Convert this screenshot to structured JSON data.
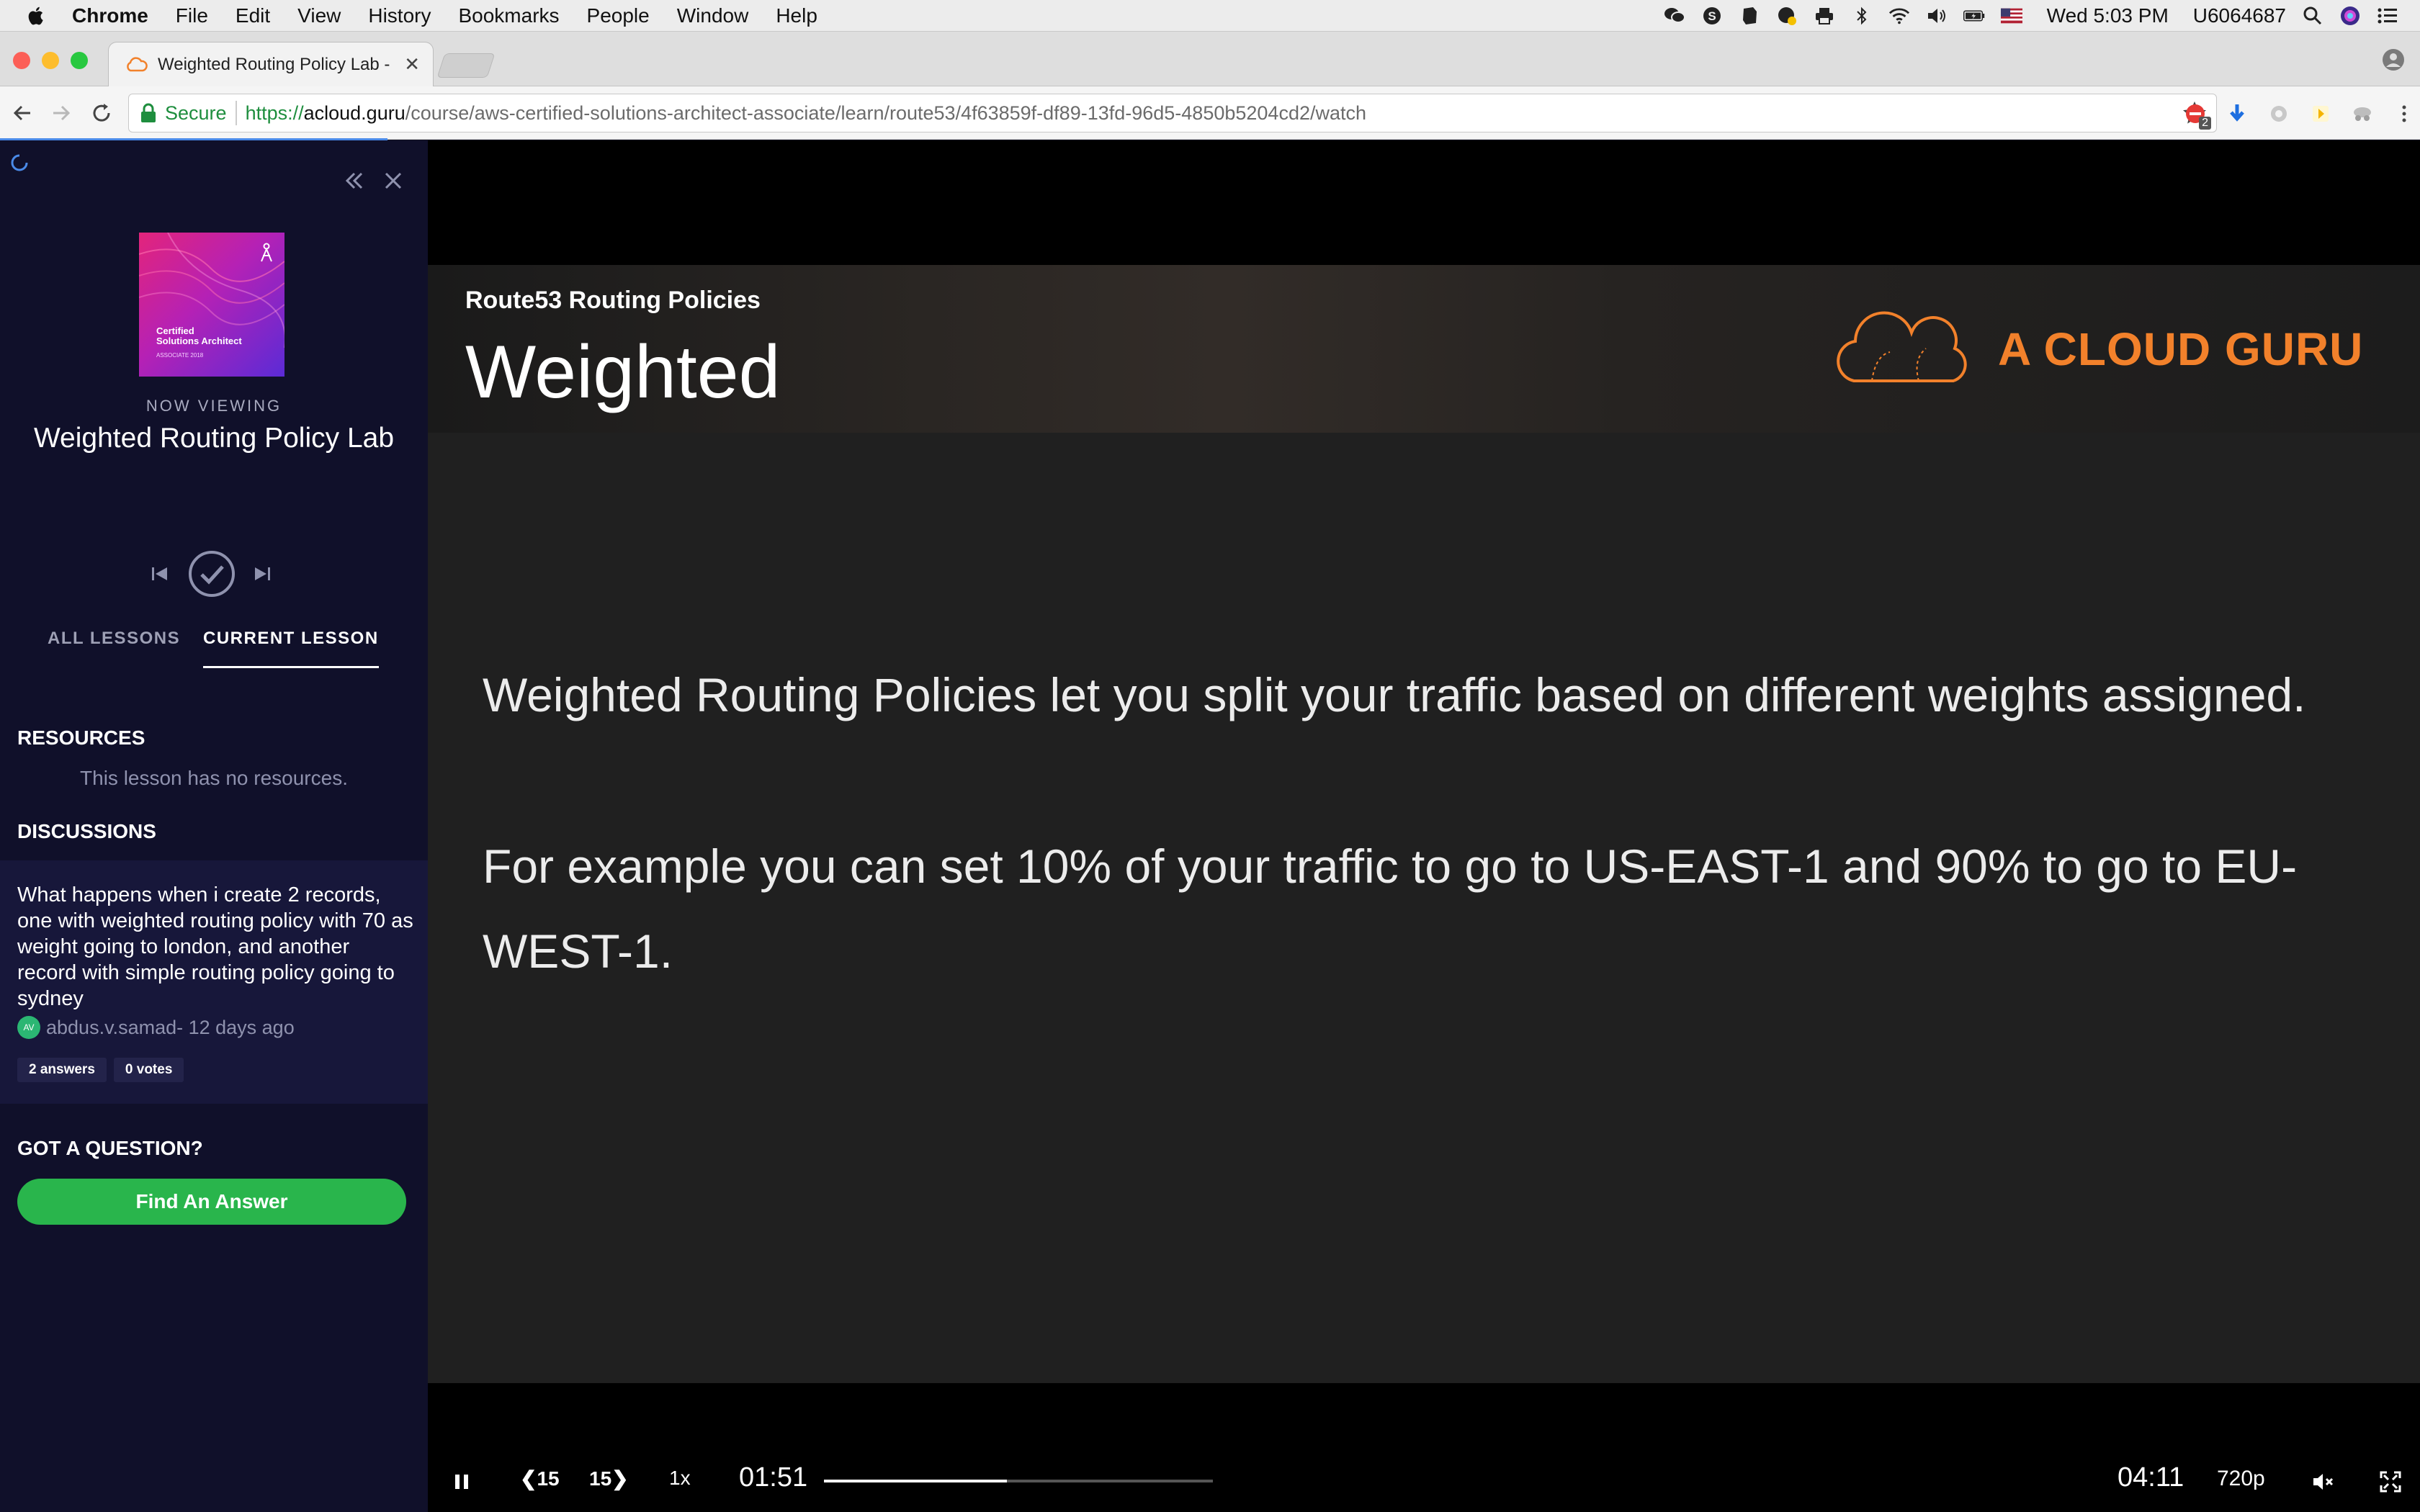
{
  "menubar": {
    "app": "Chrome",
    "items": [
      "File",
      "Edit",
      "View",
      "History",
      "Bookmarks",
      "People",
      "Window",
      "Help"
    ],
    "clock": "Wed 5:03 PM",
    "user": "U6064687"
  },
  "browser": {
    "tab_title": "Weighted Routing Policy Lab -",
    "secure_label": "Secure",
    "url_scheme": "https://",
    "url_host": "acloud.guru",
    "url_path": "/course/aws-certified-solutions-architect-associate/learn/route53/4f63859f-df89-13fd-96d5-4850b5204cd2/watch",
    "extension_badge": "2"
  },
  "sidebar": {
    "thumbnail": {
      "cert_line1": "Certified",
      "cert_line2": "Solutions Architect",
      "assoc": "ASSOCIATE 2018"
    },
    "now_viewing_label": "NOW VIEWING",
    "lesson_title": "Weighted Routing Policy Lab",
    "tabs": {
      "all": "ALL LESSONS",
      "current": "CURRENT LESSON"
    },
    "resources_heading": "RESOURCES",
    "resources_empty": "This lesson has no resources.",
    "discussions_heading": "DISCUSSIONS",
    "discussion": {
      "question": "What happens when i create 2 records, one with weighted routing policy with 70 as weight going to london, and another record with simple routing policy going to sydney",
      "avatar_initials": "AV",
      "author": "abdus.v.samad",
      "age": " - 12 days ago",
      "answers": "2 answers",
      "votes": "0 votes"
    },
    "question_heading": "GOT A QUESTION?",
    "find_answer_label": "Find An Answer"
  },
  "slide": {
    "subtitle": "Route53 Routing Policies",
    "title": "Weighted",
    "brand": "A CLOUD GURU",
    "paragraph1": "Weighted Routing Policies let you split your traffic based on different weights assigned.",
    "paragraph2": "For example you can set 10% of your traffic to go to US-EAST-1 and 90% to go to EU-WEST-1."
  },
  "player": {
    "rewind_label": "❮15",
    "forward_label": "15❯",
    "speed": "1x",
    "current_time": "01:51",
    "duration": "04:11",
    "quality": "720p",
    "progress_fraction": 0.47
  },
  "colors": {
    "accent_green": "#29b54c",
    "brand_orange": "#f2812b",
    "sidebar_bg": "#10102a"
  }
}
